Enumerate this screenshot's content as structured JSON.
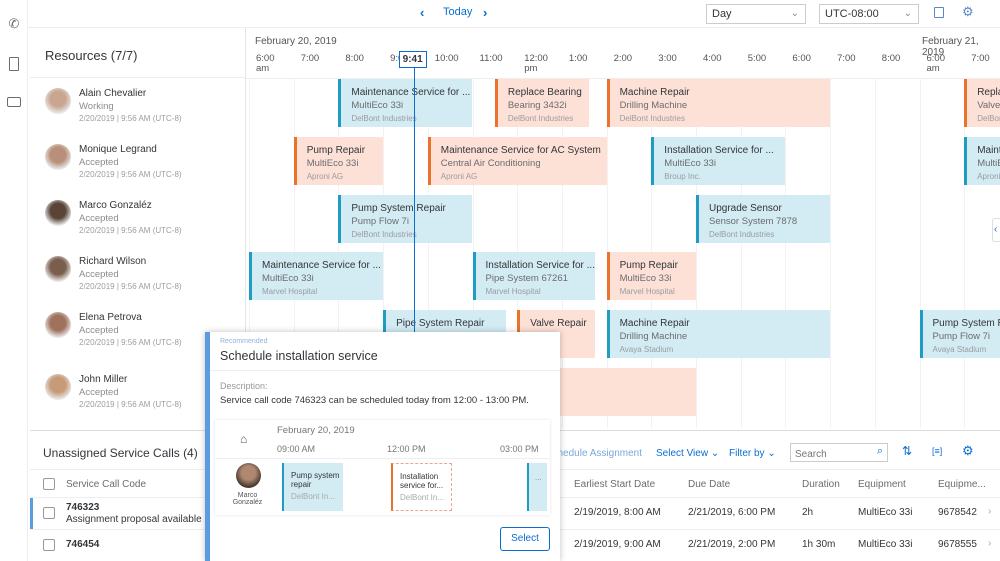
{
  "rail": [
    {
      "icon": "phone-icon"
    },
    {
      "icon": "clipboard-icon"
    },
    {
      "icon": "briefcase-icon"
    }
  ],
  "topbar": {
    "prev_icon": "chevron-left-icon",
    "today": "Today",
    "next_icon": "chevron-right-icon",
    "view": "Day",
    "timezone": "UTC-08:00",
    "icons": [
      "calendar-legend-icon",
      "settings-icon"
    ]
  },
  "resources": {
    "title": "Resources (7/7)",
    "items": [
      {
        "name": "Alain Chevalier",
        "status": "Working",
        "date": "2/20/2019 | 9:56 AM (UTC-8)",
        "color": "#c9a68f"
      },
      {
        "name": "Monique Legrand",
        "status": "Accepted",
        "date": "2/20/2019 | 9:56 AM (UTC-8)",
        "color": "#b88f78"
      },
      {
        "name": "Marco Gonzaléz",
        "status": "Accepted",
        "date": "2/20/2019 | 9:56 AM (UTC-8)",
        "color": "#5a4438"
      },
      {
        "name": "Richard Wilson",
        "status": "Accepted",
        "date": "2/20/2019 | 9:56 AM (UTC-8)",
        "color": "#7a5d4c"
      },
      {
        "name": "Elena Petrova",
        "status": "Accepted",
        "date": "2/20/2019 | 9:56 AM (UTC-8)",
        "color": "#a0715c"
      },
      {
        "name": "John Miller",
        "status": "Accepted",
        "date": "2/20/2019 | 9:56 AM (UTC-8)",
        "color": "#c79a78"
      }
    ]
  },
  "timeline": {
    "day1": "February 20, 2019",
    "day2": "February 21, 2019",
    "ticks": [
      "6:00",
      "7:00",
      "8:00",
      "9:00",
      "10:00",
      "11:00",
      "12:00",
      "1:00",
      "2:00",
      "3:00",
      "4:00",
      "5:00",
      "6:00",
      "7:00",
      "8:00",
      "6:00",
      "7:00"
    ],
    "am": "am",
    "pm": "pm",
    "now": "9:41"
  },
  "colors": {
    "blue": "#d3ebf3",
    "blue_accent": "#1f9cc2",
    "orange": "#fde0d6",
    "orange_accent": "#e9732c",
    "brand": "#0a6ed1"
  },
  "bars": [
    {
      "row": 0,
      "day": 20,
      "start": 8,
      "end": 11,
      "type": "blue",
      "title": "Maintenance Service for ...",
      "sub": "MultiEco 33i",
      "org": "DelBont Industries"
    },
    {
      "row": 0,
      "day": 20,
      "start": 11.5,
      "end": 13.6,
      "type": "orange",
      "title": "Replace Bearing",
      "sub": "Bearing 3432i",
      "org": "DelBont Industries"
    },
    {
      "row": 0,
      "day": 20,
      "start": 14,
      "end": 19,
      "type": "orange",
      "title": "Machine Repair",
      "sub": "Drilling Machine",
      "org": "DelBont Industries"
    },
    {
      "row": 0,
      "day": 21,
      "start": 7,
      "end": 9,
      "type": "orange",
      "title": "Replac",
      "sub": "Valve 1",
      "org": "DelBont"
    },
    {
      "row": 1,
      "day": 20,
      "start": 7,
      "end": 9,
      "type": "orange",
      "title": "Pump Repair",
      "sub": "MultiEco 33i",
      "org": "Aproni AG"
    },
    {
      "row": 1,
      "day": 20,
      "start": 10,
      "end": 14,
      "type": "orange",
      "title": "Maintenance Service for AC System",
      "sub": "Central Air Conditioning",
      "org": "Aproni AG"
    },
    {
      "row": 1,
      "day": 20,
      "start": 15,
      "end": 18,
      "type": "blue",
      "title": "Installation Service for ...",
      "sub": "MultiEco 33i",
      "org": "Broup Inc."
    },
    {
      "row": 1,
      "day": 21,
      "start": 7,
      "end": 9,
      "type": "blue",
      "title": "Mainte",
      "sub": "MultiEc",
      "org": "Aproni"
    },
    {
      "row": 2,
      "day": 20,
      "start": 8,
      "end": 11,
      "type": "blue",
      "title": "Pump System Repair",
      "sub": "Pump Flow 7i",
      "org": "DelBont Industries"
    },
    {
      "row": 2,
      "day": 20,
      "start": 16,
      "end": 19,
      "type": "blue",
      "title": "Upgrade Sensor",
      "sub": "Sensor System 7878",
      "org": "DelBont Industries"
    },
    {
      "row": 3,
      "day": 20,
      "start": 6,
      "end": 9,
      "type": "blue",
      "title": "Maintenance Service for ...",
      "sub": "MultiEco 33i",
      "org": "Marvel Hospital"
    },
    {
      "row": 3,
      "day": 20,
      "start": 11,
      "end": 13.75,
      "type": "blue",
      "title": "Installation Service for ...",
      "sub": "Pipe System 67261",
      "org": "Marvel Hospital"
    },
    {
      "row": 3,
      "day": 20,
      "start": 14,
      "end": 16,
      "type": "orange",
      "title": "Pump Repair",
      "sub": "MultiEco 33i",
      "org": "Marvel Hospital"
    },
    {
      "row": 4,
      "day": 20,
      "start": 9,
      "end": 11.75,
      "type": "blue",
      "title": "Pipe System Repair",
      "sub": "",
      "org": ""
    },
    {
      "row": 4,
      "day": 20,
      "start": 12,
      "end": 13.75,
      "type": "orange",
      "title": "Valve Repair",
      "sub": "126",
      "org": "adium"
    },
    {
      "row": 4,
      "day": 20,
      "start": 14,
      "end": 19,
      "type": "blue",
      "title": "Machine Repair",
      "sub": "Drilling Machine",
      "org": "Avaya Stadium"
    },
    {
      "row": 4,
      "day": 21,
      "start": 6,
      "end": 9,
      "type": "blue",
      "title": "Pump System Re",
      "sub": "Pump Flow 7i",
      "org": "Avaya Stadium"
    },
    {
      "row": 5,
      "day": 20,
      "start": 12.25,
      "end": 16,
      "type": "orange",
      "title": "",
      "sub": "",
      "org": ""
    }
  ],
  "unassigned": {
    "title": "Unassigned Service Calls (4)",
    "toolbar": {
      "schedule": "Schedule Assignment",
      "select_view": "Select View",
      "filter_by": "Filter by",
      "search_placeholder": "Search",
      "icons": [
        "search-icon",
        "sort-icon",
        "column-settings-icon",
        "settings-icon"
      ]
    },
    "columns": [
      "Service Call Code",
      "Earliest Start Date",
      "Due Date",
      "Duration",
      "Equipment",
      "Equipme..."
    ],
    "rows": [
      {
        "code": "746323",
        "proposal": "Assignment proposal available",
        "start": "2/19/2019, 8:00 AM",
        "due": "2/21/2019, 6:00 PM",
        "duration": "2h",
        "equipment": "MultiEco 33i",
        "equipment_id": "9678542"
      },
      {
        "code": "746454",
        "proposal": "",
        "start": "2/19/2019, 9:00 AM",
        "due": "2/21/2019, 2:00 PM",
        "duration": "1h 30m",
        "equipment": "MultiEco 33i",
        "equipment_id": "9678555"
      }
    ]
  },
  "popup": {
    "label": "Recommended",
    "title": "Schedule installation service",
    "desc_label": "Description:",
    "desc": "Service call code 746323 can be scheduled today from 12:00 - 13:00 PM.",
    "mini": {
      "date": "February 20, 2019",
      "ticks": [
        "09:00 AM",
        "12:00 PM",
        "03:00 PM"
      ],
      "person": "Marco Gonzaléz",
      "bars": [
        {
          "title": "Pump system repair",
          "org": "DelBont In..."
        },
        {
          "title": "Installation service for...",
          "org": "DelBont In..."
        },
        {
          "title": "..."
        }
      ]
    },
    "select": "Select"
  }
}
